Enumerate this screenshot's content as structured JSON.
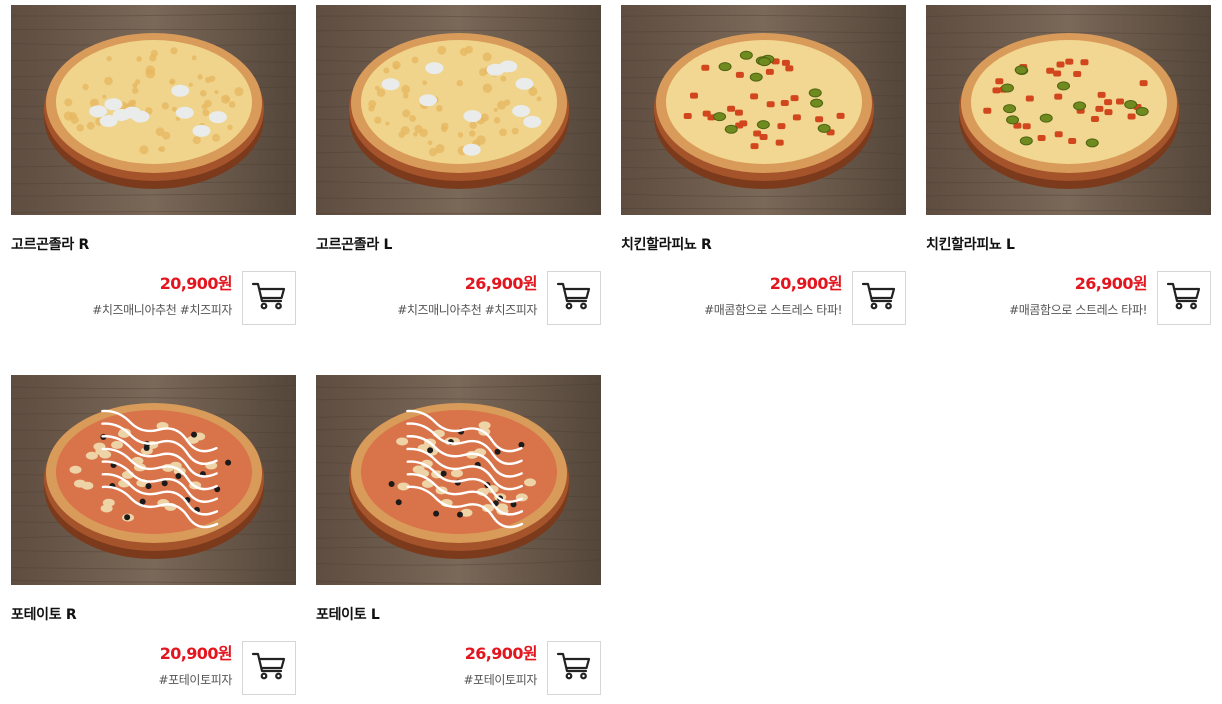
{
  "products": [
    {
      "name": "고르곤졸라 R",
      "price": "20,900원",
      "tag": "#치즈매니아추천 #치즈피자",
      "cart_icon": "shopping-cart-icon",
      "pizza": "gorgonzola"
    },
    {
      "name": "고르곤졸라 L",
      "price": "26,900원",
      "tag": "#치즈매니아추천 #치즈피자",
      "cart_icon": "shopping-cart-icon",
      "pizza": "gorgonzola"
    },
    {
      "name": "치킨할라피뇨 R",
      "price": "20,900원",
      "tag": "#매콤함으로 스트레스 타파!",
      "cart_icon": "shopping-cart-icon",
      "pizza": "chicken-jalapeno"
    },
    {
      "name": "치킨할라피뇨 L",
      "price": "26,900원",
      "tag": "#매콤함으로 스트레스 타파!",
      "cart_icon": "shopping-cart-icon",
      "pizza": "chicken-jalapeno"
    },
    {
      "name": "포테이토 R",
      "price": "20,900원",
      "tag": "#포테이토피자",
      "cart_icon": "shopping-cart-icon",
      "pizza": "potato"
    },
    {
      "name": "포테이토 L",
      "price": "26,900원",
      "tag": "#포테이토피자",
      "cart_icon": "shopping-cart-icon",
      "pizza": "potato"
    }
  ],
  "colors": {
    "price": "#e3151e",
    "wood_background": "#6b5a4c",
    "cart_border": "#d6d6d6"
  }
}
